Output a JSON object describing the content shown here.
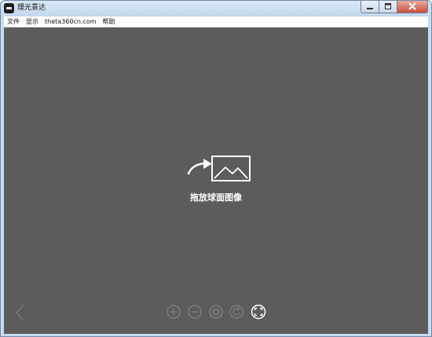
{
  "window": {
    "title": "理光景达",
    "controls": {
      "minimize_icon": "minimize-icon",
      "maximize_icon": "maximize-icon",
      "close_icon": "close-icon"
    }
  },
  "menubar": {
    "items": [
      {
        "label": "文件"
      },
      {
        "label": "显示"
      },
      {
        "label": "theta360cn.com"
      },
      {
        "label": "帮助"
      }
    ]
  },
  "viewer": {
    "drop_icon": "drop-image-icon",
    "drop_label": "拖放球面图像",
    "prev_icon": "chevron-left-icon",
    "toolbar": [
      {
        "icon": "zoom-in-icon",
        "enabled": false
      },
      {
        "icon": "zoom-out-icon",
        "enabled": false
      },
      {
        "icon": "settings-icon",
        "enabled": false
      },
      {
        "icon": "rotate-icon",
        "enabled": false
      },
      {
        "icon": "fullscreen-icon",
        "enabled": true
      }
    ]
  },
  "colors": {
    "canvas_bg": "#5c5c5c",
    "icon_disabled": "#7d7d7d",
    "icon_enabled": "#ffffff",
    "titlebar": "#c8dcef"
  }
}
